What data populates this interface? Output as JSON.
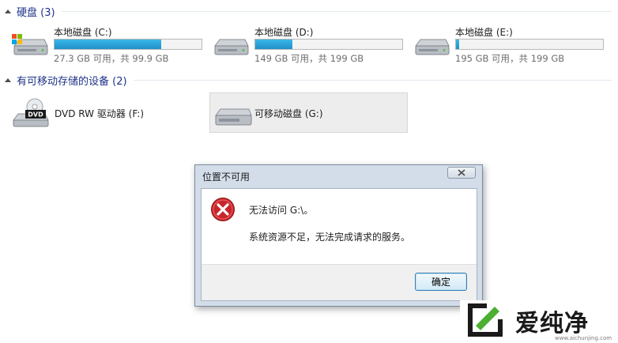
{
  "groups": {
    "hard_disks": {
      "title": "硬盘 (3)"
    },
    "removable": {
      "title": "有可移动存储的设备 (2)"
    }
  },
  "drives": [
    {
      "name": "本地磁盘 (C:)",
      "space": "27.3 GB 可用，共 99.9 GB",
      "used_fraction": 0.727
    },
    {
      "name": "本地磁盘 (D:)",
      "space": "149 GB 可用，共 199 GB",
      "used_fraction": 0.25
    },
    {
      "name": "本地磁盘 (E:)",
      "space": "195 GB 可用，共 199 GB",
      "used_fraction": 0.02
    }
  ],
  "devices": [
    {
      "name": "DVD RW 驱动器 (F:)",
      "icon_text": "DVD"
    },
    {
      "name": "可移动磁盘 (G:)"
    }
  ],
  "dialog": {
    "title": "位置不可用",
    "message": "无法访问 G:\\。",
    "detail": "系统资源不足，无法完成请求的服务。",
    "ok_label": "确定"
  },
  "watermark": {
    "brand": "爱纯净",
    "url": "www.aichunjing.com"
  },
  "colors": {
    "group_title": "#1e3287",
    "bar_fill": "#26a0da",
    "error": "#c8262b"
  }
}
